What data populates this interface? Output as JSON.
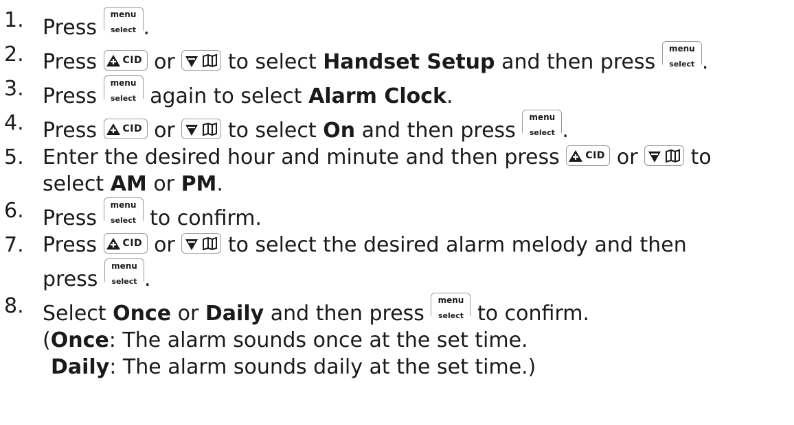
{
  "steps": [
    {
      "num": "1.",
      "parts": [
        "Press",
        "."
      ]
    },
    {
      "num": "2.",
      "parts": [
        "Press",
        "or",
        "to select",
        "Handset Setup",
        "and then press",
        "."
      ]
    },
    {
      "num": "3.",
      "parts": [
        "Press",
        "again to select",
        "Alarm Clock",
        "."
      ]
    },
    {
      "num": "4.",
      "parts": [
        "Press",
        "or",
        "to select",
        "On",
        "and then press",
        "."
      ]
    },
    {
      "num": "5.",
      "parts": [
        "Enter the desired hour and minute and then press",
        "or",
        "to",
        "select",
        "AM",
        "or",
        "PM",
        "."
      ]
    },
    {
      "num": "6.",
      "parts": [
        "Press",
        "to confirm."
      ]
    },
    {
      "num": "7.",
      "parts": [
        "Press",
        "or",
        "to select the desired alarm melody and then",
        "press",
        "."
      ]
    },
    {
      "num": "8.",
      "parts": [
        "Select",
        "Once",
        "or",
        "Daily",
        "and then press",
        "to confirm."
      ]
    }
  ],
  "note": {
    "open": "(",
    "once_term": "Once",
    "once_text": ": The alarm sounds once at the set time.",
    "daily_term": "Daily",
    "daily_text": ": The alarm sounds daily at the set time.)"
  },
  "keys": {
    "menu_top": "menu",
    "menu_bottom": "select",
    "cid_label": "CID",
    "up_icon": "up-triangle-plus-icon",
    "down_icon": "down-triangle-icon",
    "book_icon": "phonebook-icon"
  }
}
